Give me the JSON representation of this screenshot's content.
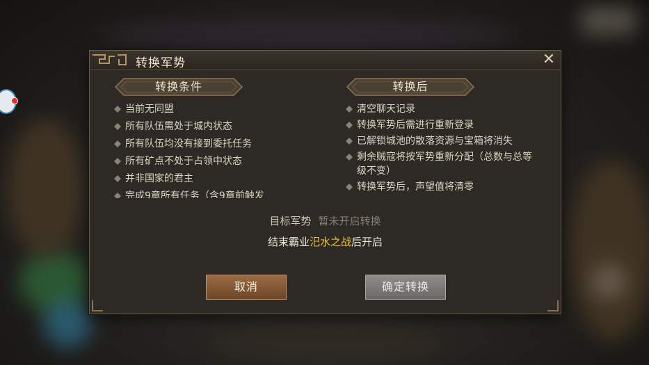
{
  "dialog": {
    "title": "转换军势",
    "close_symbol": "✕"
  },
  "conditions": {
    "header": "转换条件",
    "items": [
      "当前无同盟",
      "所有队伍需处于城内状态",
      "所有队伍均没有接到委托任务",
      "所有矿点不处于占领中状态",
      "并非国家的君主",
      "完成9章所有任务（含9章前触发"
    ]
  },
  "after": {
    "header": "转换后",
    "items": [
      "清空聊天记录",
      "转换军势后需进行重新登录",
      "已解锁城池的散落资源与宝箱将消失",
      "剩余贼寇将按军势重新分配（总数与总等级不变）",
      "转换军势后，声望值将清零"
    ]
  },
  "target": {
    "label": "目标军势",
    "value": "暂未开启转换"
  },
  "note": {
    "prefix": "结束霸业",
    "highlight": "汜水之战",
    "suffix": "后开启"
  },
  "buttons": {
    "cancel": "取消",
    "confirm": "确定转换"
  },
  "colors": {
    "accent_gold": "#f0c43a",
    "cancel_button": "#8a5c38",
    "confirm_button_disabled": "#7c7b78",
    "panel": "#2d2925"
  }
}
